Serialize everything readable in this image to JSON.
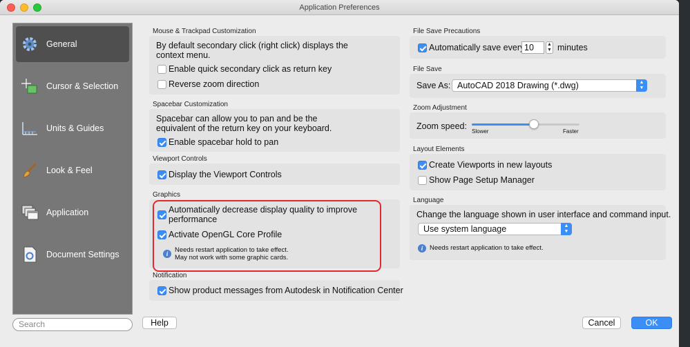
{
  "window": {
    "title": "Application Preferences"
  },
  "sidebar": {
    "items": [
      {
        "label": "General",
        "icon": "gear-icon",
        "active": true
      },
      {
        "label": "Cursor & Selection",
        "icon": "crosshair-icon",
        "active": false
      },
      {
        "label": "Units & Guides",
        "icon": "ruler-icon",
        "active": false
      },
      {
        "label": "Look & Feel",
        "icon": "brush-icon",
        "active": false
      },
      {
        "label": "Application",
        "icon": "windows-icon",
        "active": false
      },
      {
        "label": "Document Settings",
        "icon": "document-icon",
        "active": false
      }
    ],
    "search_placeholder": "Search"
  },
  "mouse": {
    "title": "Mouse & Trackpad Customization",
    "desc_line1": "By default secondary click (right click) displays the",
    "desc_line2": "context menu.",
    "opt1": {
      "label": "Enable quick secondary click as return key",
      "checked": false
    },
    "opt2": {
      "label": "Reverse zoom direction",
      "checked": false
    }
  },
  "spacebar": {
    "title": "Spacebar Customization",
    "desc_line1": "Spacebar can allow you to pan and be the",
    "desc_line2": "equivalent of the return key on your keyboard.",
    "opt1": {
      "label": "Enable spacebar hold to pan",
      "checked": true
    }
  },
  "viewport": {
    "title": "Viewport Controls",
    "opt1": {
      "label": "Display the Viewport Controls",
      "checked": true
    }
  },
  "graphics": {
    "title": "Graphics",
    "opt1_line1": "Automatically decrease display quality to improve",
    "opt1_line2": "performance",
    "opt1_checked": true,
    "opt2": {
      "label": "Activate OpenGL Core Profile",
      "checked": true
    },
    "note_line1": "Needs restart application to take effect.",
    "note_line2": "May not work with some graphic cards."
  },
  "notification": {
    "title": "Notification",
    "opt1": {
      "label": "Show product messages from Autodesk in Notification Center",
      "checked": true
    }
  },
  "filesave_prec": {
    "title": "File Save Precautions",
    "label": "Automatically save every",
    "value": "10",
    "unit": "minutes",
    "checked": true
  },
  "filesave": {
    "title": "File Save",
    "label": "Save As:",
    "value": "AutoCAD 2018 Drawing (*.dwg)"
  },
  "zoom": {
    "title": "Zoom Adjustment",
    "label": "Zoom speed:",
    "min_label": "Slower",
    "max_label": "Faster",
    "level": 0.58
  },
  "layout": {
    "title": "Layout Elements",
    "opt1": {
      "label": "Create Viewports in new layouts",
      "checked": true
    },
    "opt2": {
      "label": "Show Page Setup Manager",
      "checked": false
    }
  },
  "language": {
    "title": "Language",
    "desc": "Change the language shown in user interface and command input.",
    "value": "Use system language",
    "note": "Needs restart application to take effect."
  },
  "buttons": {
    "help": "Help",
    "cancel": "Cancel",
    "ok": "OK"
  },
  "colors": {
    "accent": "#3a8ef6",
    "highlight": "#e0282e",
    "sidebar": "#777777"
  }
}
